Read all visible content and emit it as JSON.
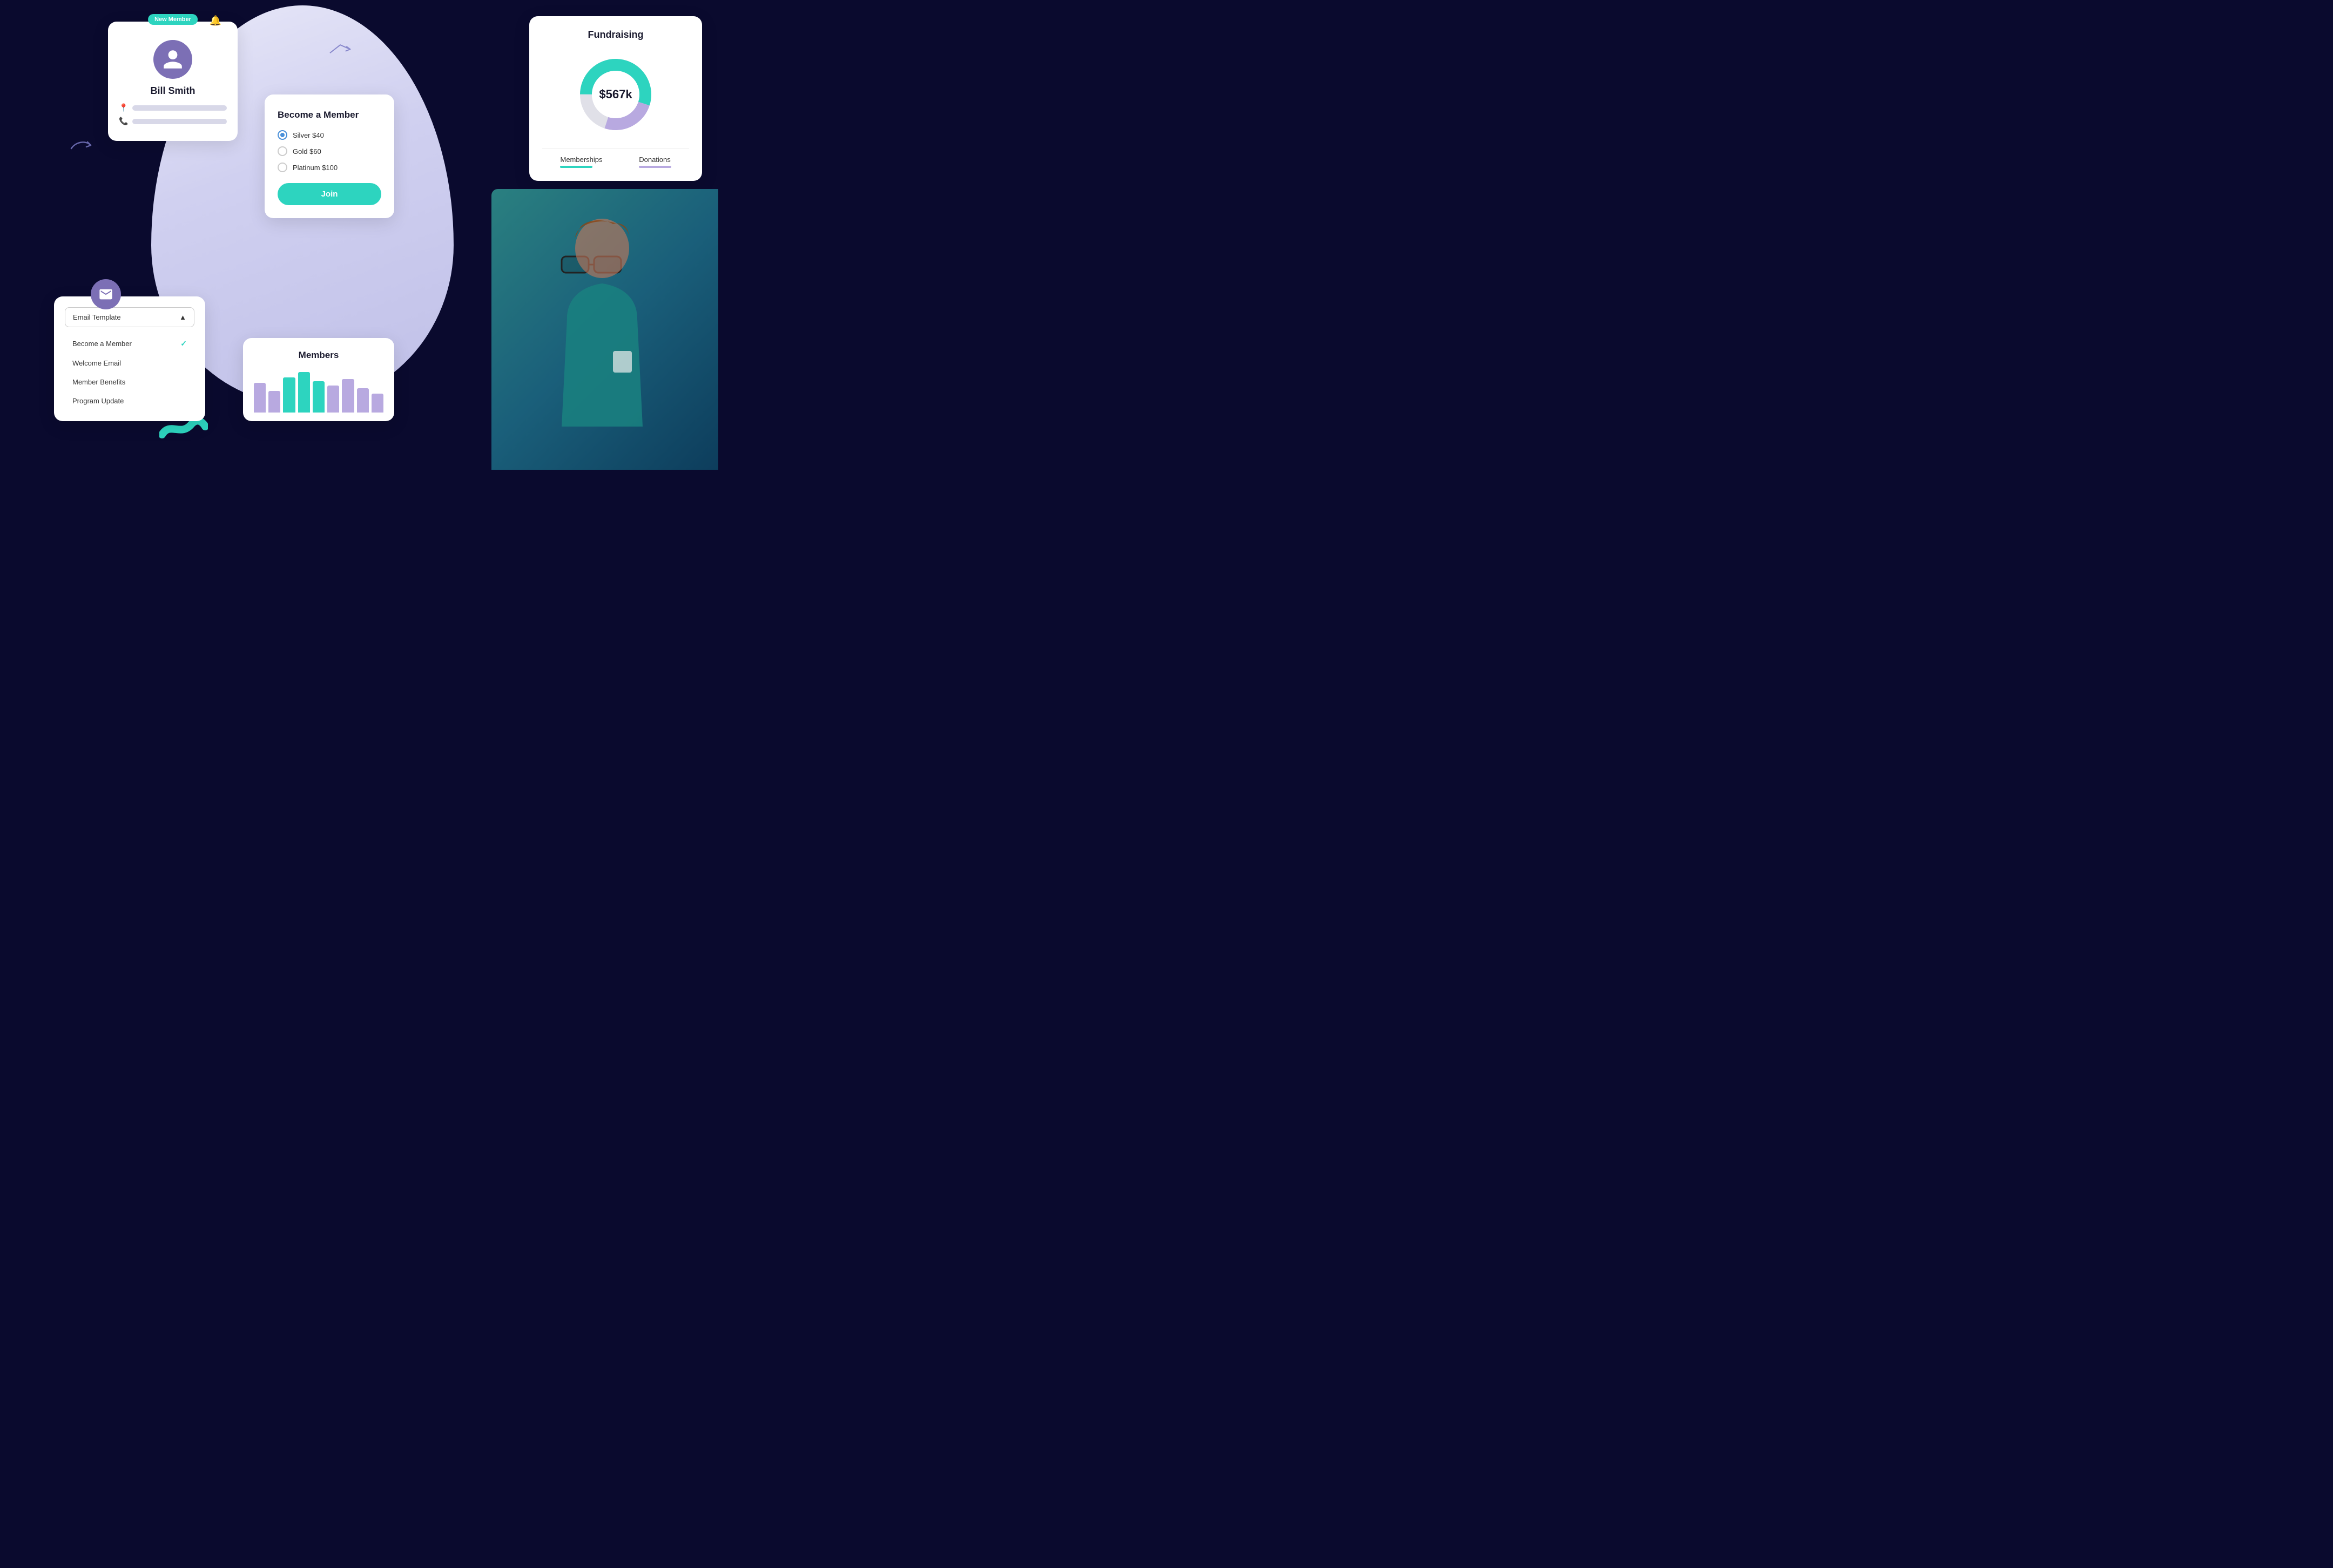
{
  "background": {
    "color": "#0a0a2e"
  },
  "profile_card": {
    "badge": "New Member",
    "name": "Bill Smith",
    "avatar_label": "user avatar"
  },
  "email_card": {
    "select_label": "Email Template",
    "chevron": "▲",
    "options": [
      {
        "label": "Become a Member",
        "selected": true
      },
      {
        "label": "Welcome Email",
        "selected": false
      },
      {
        "label": "Member Benefits",
        "selected": false
      },
      {
        "label": "Program Update",
        "selected": false
      }
    ]
  },
  "member_card": {
    "title": "Become a Member",
    "options": [
      {
        "label": "Silver $40",
        "selected": true
      },
      {
        "label": "Gold $60",
        "selected": false
      },
      {
        "label": "Platinum $100",
        "selected": false
      }
    ],
    "button_label": "Join"
  },
  "fundraising_card": {
    "title": "Fundraising",
    "amount": "$567k",
    "legend": [
      {
        "label": "Memberships",
        "color": "#2dd4bf"
      },
      {
        "label": "Donations",
        "color": "#b8a9e0"
      }
    ],
    "donut": {
      "segments": [
        {
          "label": "teal",
          "color": "#2dd4bf",
          "percent": 55
        },
        {
          "label": "light-gray",
          "color": "#e0e0e8",
          "percent": 20
        },
        {
          "label": "purple",
          "color": "#b8a9e0",
          "percent": 25
        }
      ]
    }
  },
  "chart_card": {
    "title": "Members",
    "bars": [
      {
        "height": 55,
        "color": "#b8a9e0"
      },
      {
        "height": 40,
        "color": "#b8a9e0"
      },
      {
        "height": 65,
        "color": "#2dd4bf"
      },
      {
        "height": 75,
        "color": "#2dd4bf"
      },
      {
        "height": 58,
        "color": "#2dd4bf"
      },
      {
        "height": 50,
        "color": "#b8a9e0"
      },
      {
        "height": 62,
        "color": "#b8a9e0"
      },
      {
        "height": 45,
        "color": "#b8a9e0"
      },
      {
        "height": 35,
        "color": "#b8a9e0"
      }
    ]
  }
}
